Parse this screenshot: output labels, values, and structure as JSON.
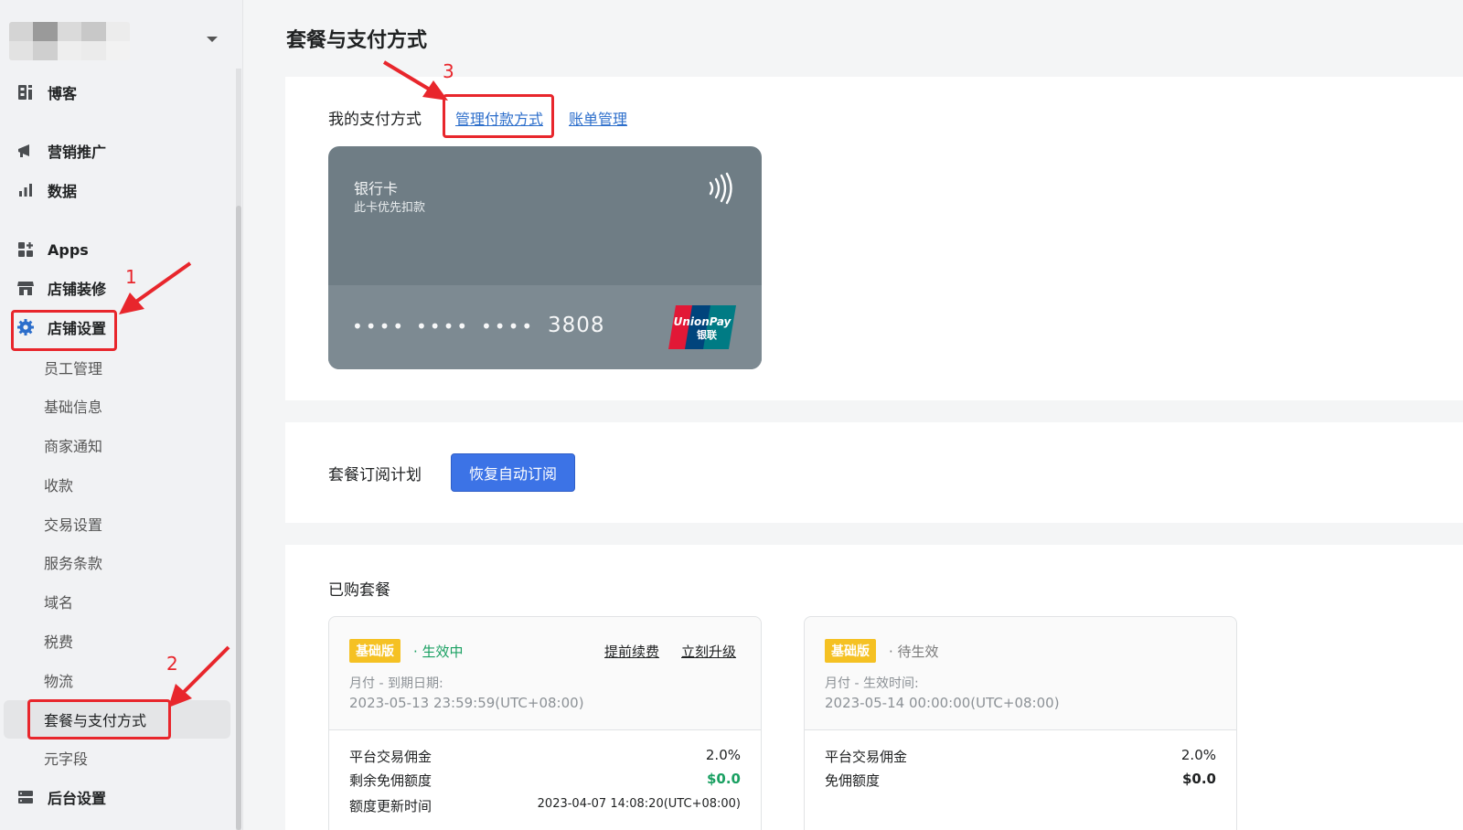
{
  "sidebar": {
    "nav": [
      {
        "label": "博客",
        "icon": "blog-icon"
      },
      {
        "label": "营销推广",
        "icon": "megaphone-icon"
      },
      {
        "label": "数据",
        "icon": "bar-chart-icon"
      },
      {
        "label": "Apps",
        "icon": "apps-grid-icon"
      },
      {
        "label": "店铺装修",
        "icon": "storefront-icon"
      },
      {
        "label": "店铺设置",
        "icon": "gear-icon"
      }
    ],
    "sub": [
      "员工管理",
      "基础信息",
      "商家通知",
      "收款",
      "交易设置",
      "服务条款",
      "域名",
      "税费",
      "物流",
      "套餐与支付方式",
      "元字段"
    ],
    "bottom": {
      "label": "后台设置",
      "icon": "server-icon"
    }
  },
  "annotations": {
    "n1": "1",
    "n2": "2",
    "n3": "3"
  },
  "page": {
    "title": "套餐与支付方式"
  },
  "payment": {
    "title": "我的支付方式",
    "manage_link": "管理付款方式",
    "billing_link": "账单管理",
    "card": {
      "type": "银行卡",
      "note": "此卡优先扣款",
      "dots": [
        "••••",
        "••••",
        "••••"
      ],
      "last4": "3808",
      "brand_top": "UnionPay",
      "brand_bottom": "银联"
    }
  },
  "plan": {
    "title": "套餐订阅计划",
    "resume_button": "恢复自动订阅"
  },
  "purchased": {
    "title": "已购套餐",
    "cards": [
      {
        "badge": "基础版",
        "status": "· 生效中",
        "actions": [
          "提前续费",
          "立刻升级"
        ],
        "meta": "月付 - 到期日期:",
        "date": "2023-05-13 23:59:59(UTC+08:00)",
        "rows": [
          {
            "label": "平台交易佣金",
            "value": "2.0%"
          },
          {
            "label": "剩余免佣额度",
            "value": "$0.0"
          },
          {
            "label": "额度更新时间",
            "value": "2023-04-07 14:08:20(UTC+08:00)"
          }
        ]
      },
      {
        "badge": "基础版",
        "status": "· 待生效",
        "meta": "月付 - 生效时间:",
        "date": "2023-05-14 00:00:00(UTC+08:00)",
        "rows": [
          {
            "label": "平台交易佣金",
            "value": "2.0%"
          },
          {
            "label": "免佣额度",
            "value": "$0.0"
          }
        ]
      }
    ]
  },
  "colors": {
    "accent": "#3c73e6",
    "link": "#2c6ecb",
    "annotation": "#e8262c",
    "active_status": "#1aa062",
    "badge": "#f5c123"
  }
}
